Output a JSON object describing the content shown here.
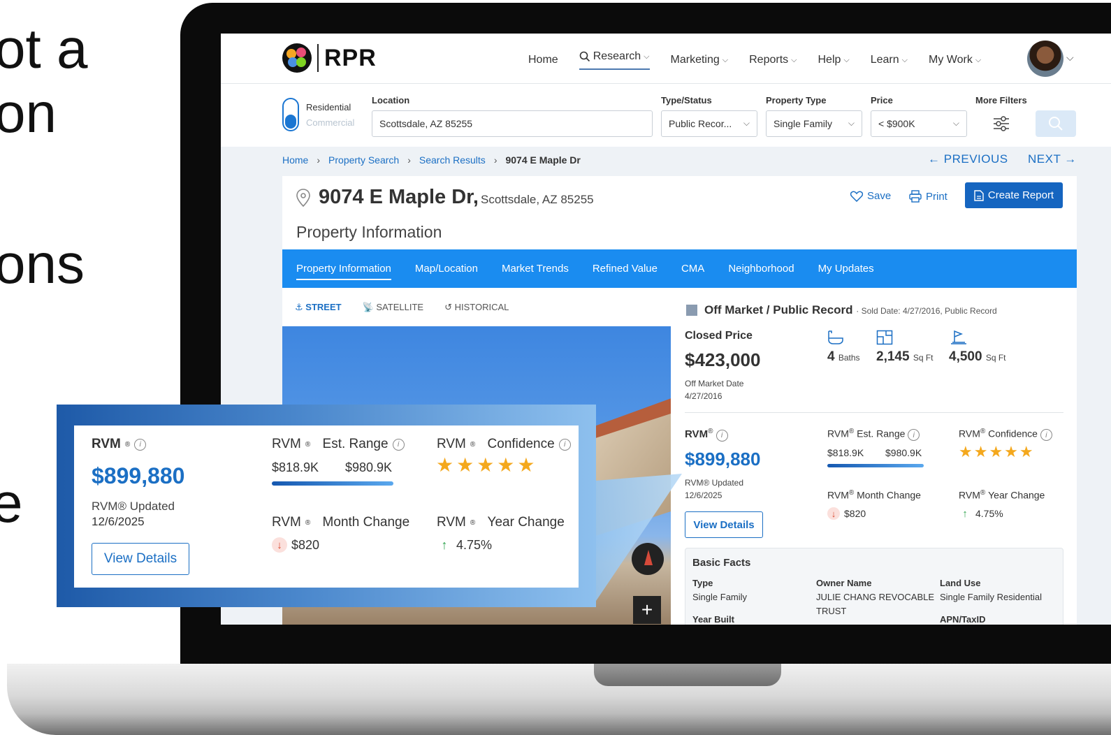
{
  "hero": {
    "line1": "ot a",
    "line2": "on",
    "line3": "ons",
    "line4": "e"
  },
  "header": {
    "logo_text": "RPR",
    "nav": [
      "Home",
      "Research",
      "Marketing",
      "Reports",
      "Help",
      "Learn",
      "My Work"
    ]
  },
  "search": {
    "segment_residential": "Residential",
    "segment_commercial": "Commercial",
    "location_label": "Location",
    "location_value": "Scottsdale, AZ 85255",
    "type_label": "Type/Status",
    "type_value": "Public Recor...",
    "ptype_label": "Property Type",
    "ptype_value": "Single Family",
    "price_label": "Price",
    "price_value": "< $900K",
    "more_filters_label": "More Filters"
  },
  "breadcrumb": [
    "Home",
    "Property Search",
    "Search Results",
    "9074 E Maple Dr"
  ],
  "pager": {
    "previous": "PREVIOUS",
    "next": "NEXT"
  },
  "property": {
    "address": "9074 E Maple Dr,",
    "city": "Scottsdale, AZ 85255",
    "save": "Save",
    "print": "Print",
    "create_report": "Create Report",
    "section_title": "Property Information"
  },
  "tabs": [
    "Property Information",
    "Map/Location",
    "Market Trends",
    "Refined Value",
    "CMA",
    "Neighborhood",
    "My Updates"
  ],
  "views": [
    "STREET",
    "SATELLITE",
    "HISTORICAL"
  ],
  "details": {
    "status": "Off Market / Public Record",
    "status_sub": "· Sold Date: 4/27/2016, Public Record",
    "closed_price_label": "Closed Price",
    "closed_price": "$423,000",
    "off_market_label": "Off Market Date",
    "off_market_date": "4/27/2016",
    "baths": "4",
    "baths_unit": "Baths",
    "sqft": "2,145",
    "sqft_unit": "Sq Ft",
    "lot": "4,500",
    "lot_unit": "Sq Ft"
  },
  "rvm": {
    "label": "RVM",
    "value": "$899,880",
    "updated_label": "RVM® Updated",
    "updated_date": "12/6/2025",
    "range_label": "Est. Range",
    "range_low": "$818.9K",
    "range_high": "$980.9K",
    "confidence_label": "Confidence",
    "confidence_stars": 5,
    "month_change_label": "Month Change",
    "month_change": "$820",
    "year_change_label": "Year Change",
    "year_change": "4.75%",
    "view_details": "View Details"
  },
  "basic_facts": {
    "title": "Basic Facts",
    "type_label": "Type",
    "type_value": "Single Family",
    "owner_label": "Owner Name",
    "owner_value_1": "JULIE CHANG REVOCABLE",
    "owner_value_2": "TRUST",
    "land_use_label": "Land Use",
    "land_use_value": "Single Family Residential",
    "year_built_label": "Year Built",
    "apn_label": "APN/TaxID"
  },
  "colors": {
    "brand_blue": "#1b6fc4",
    "tab_blue": "#1a8cf0",
    "button_blue": "#1565c0",
    "star": "#f4a81d"
  }
}
